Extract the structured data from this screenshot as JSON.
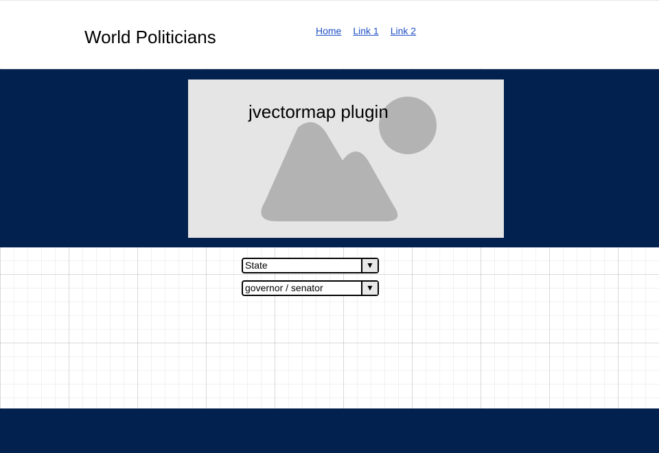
{
  "header": {
    "title": "World Politicians",
    "nav": [
      {
        "label": "Home"
      },
      {
        "label": "Link 1"
      },
      {
        "label": "Link 2"
      }
    ]
  },
  "hero": {
    "placeholder_label": "jvectormap plugin",
    "placeholder_icon": "image-placeholder-icon"
  },
  "filters": {
    "state_select": {
      "value": "State",
      "icon": "dropdown-arrow-icon"
    },
    "role_select": {
      "value": "governor / senator",
      "icon": "dropdown-arrow-icon"
    }
  },
  "colors": {
    "navy": "#03214f",
    "link": "#1e4fc7",
    "placeholder_bg": "#e5e5e5",
    "placeholder_shape": "#b3b3b3"
  }
}
